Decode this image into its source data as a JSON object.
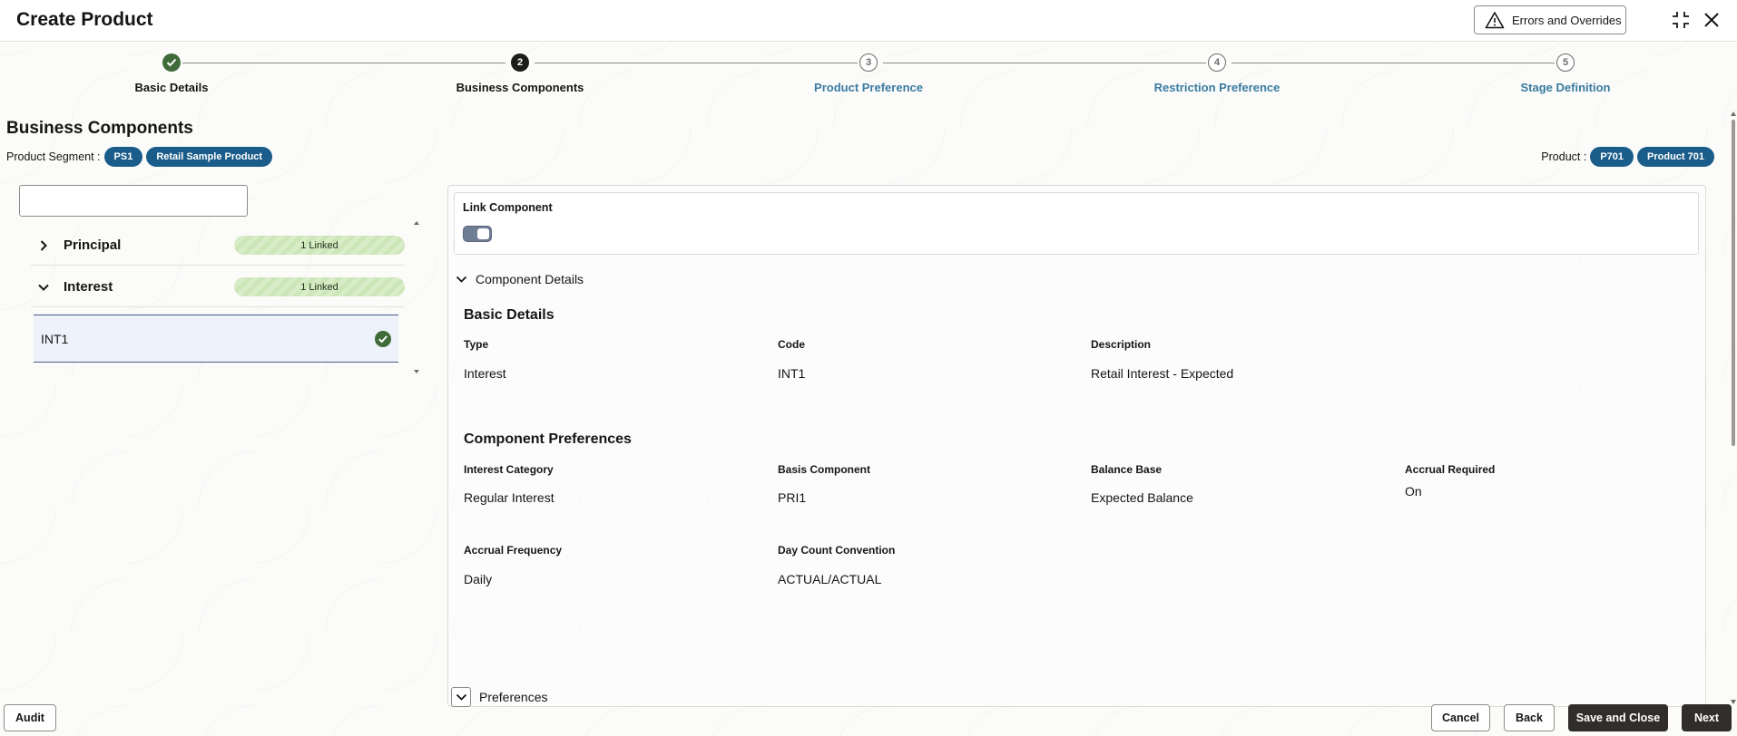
{
  "header": {
    "title": "Create Product",
    "errors_label": "Errors and Overrides"
  },
  "train": {
    "steps": [
      {
        "label": "Basic Details",
        "state": "done",
        "number": "1"
      },
      {
        "label": "Business Components",
        "state": "current",
        "number": "2"
      },
      {
        "label": "Product Preference",
        "state": "future",
        "number": "3"
      },
      {
        "label": "Restriction Preference",
        "state": "future",
        "number": "4"
      },
      {
        "label": "Stage Definition",
        "state": "future",
        "number": "5"
      }
    ]
  },
  "section": {
    "title": "Business Components",
    "segment_label": "Product Segment :",
    "segment_code": "PS1",
    "segment_name": "Retail Sample Product",
    "product_label": "Product :",
    "product_code": "P701",
    "product_name": "Product 701"
  },
  "tree": {
    "search_value": "",
    "groups": [
      {
        "label": "Principal",
        "badge": "1 Linked",
        "expanded": false
      },
      {
        "label": "Interest",
        "badge": "1 Linked",
        "expanded": true
      }
    ],
    "selected_item": "INT1"
  },
  "detail": {
    "link_component_label": "Link Component",
    "link_component_on": true,
    "component_details_label": "Component Details",
    "basic_details_title": "Basic Details",
    "basic": {
      "type_label": "Type",
      "type_value": "Interest",
      "code_label": "Code",
      "code_value": "INT1",
      "desc_label": "Description",
      "desc_value": "Retail Interest - Expected"
    },
    "prefs_title": "Component Preferences",
    "prefs": {
      "category_label": "Interest Category",
      "category_value": "Regular Interest",
      "basis_label": "Basis Component",
      "basis_value": "PRI1",
      "balance_label": "Balance Base",
      "balance_value": "Expected Balance",
      "accrual_req_label": "Accrual Required",
      "accrual_req_value": "On",
      "accrual_freq_label": "Accrual Frequency",
      "accrual_freq_value": "Daily",
      "daycount_label": "Day Count Convention",
      "daycount_value": "ACTUAL/ACTUAL"
    },
    "preferences_label": "Preferences"
  },
  "footer": {
    "audit": "Audit",
    "cancel": "Cancel",
    "back": "Back",
    "save_close": "Save and Close",
    "next": "Next"
  }
}
